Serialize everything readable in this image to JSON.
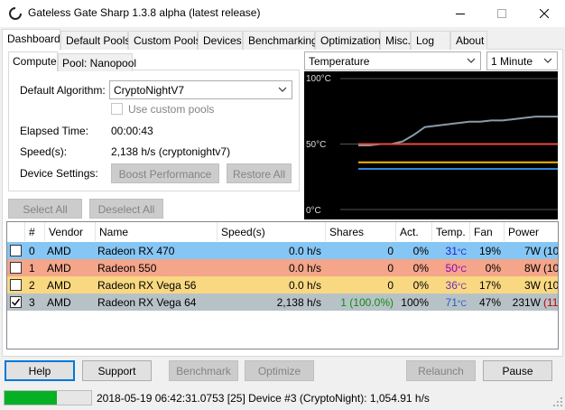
{
  "window": {
    "title": "Gateless Gate Sharp 1.3.8 alpha (latest release)"
  },
  "tabs": [
    "Dashboard",
    "Default Pools",
    "Custom Pools",
    "Devices",
    "Benchmarking",
    "Optimization",
    "Misc.",
    "Log",
    "About"
  ],
  "subtabs": [
    "Compute",
    "Pool: Nanopool"
  ],
  "compute": {
    "default_algorithm_label": "Default Algorithm:",
    "default_algorithm_value": "CryptoNightV7",
    "use_custom_pools_label": "Use custom pools",
    "elapsed_label": "Elapsed Time:",
    "elapsed_value": "00:00:43",
    "speed_label": "Speed(s):",
    "speed_value": "2,138 h/s (cryptonightv7)",
    "device_settings_label": "Device Settings:",
    "boost_label": "Boost Performance",
    "restore_label": "Restore All"
  },
  "select_all_label": "Select All",
  "deselect_all_label": "Deselect All",
  "chart_controls": {
    "metric": "Temperature",
    "interval": "1 Minute"
  },
  "chart_data": {
    "type": "line",
    "y_ticks": [
      "100°C",
      "50°C",
      "0°C"
    ],
    "ylim": [
      0,
      100
    ],
    "series": [
      {
        "color": "#8a9ba8",
        "values": [
          49,
          49,
          50,
          50,
          52,
          57,
          63,
          64,
          65,
          66,
          67,
          67,
          68,
          68,
          69,
          70,
          71,
          71,
          71
        ]
      },
      {
        "color": "#e74c3c",
        "values": [
          50,
          50,
          50,
          50,
          50,
          50,
          50,
          50,
          50,
          50,
          50,
          50,
          50,
          50,
          50,
          50,
          50,
          50,
          50
        ]
      },
      {
        "color": "#f5b400",
        "values": [
          36,
          36,
          36,
          36,
          36,
          36,
          36,
          36,
          36,
          36,
          36,
          36,
          36,
          36,
          36,
          36,
          36,
          36,
          36
        ]
      },
      {
        "color": "#9b6bd6",
        "values": [
          31,
          31,
          31,
          31,
          31,
          31,
          31,
          31,
          31,
          31,
          31,
          31,
          31,
          31,
          31,
          31,
          31,
          31,
          31
        ]
      },
      {
        "color": "#2e86de",
        "values": [
          31,
          31,
          31,
          31,
          31,
          31,
          31,
          31,
          31,
          31,
          31,
          31,
          31,
          31,
          31,
          31,
          31,
          31,
          31
        ]
      }
    ]
  },
  "table": {
    "headers": [
      "#",
      "Vendor",
      "Name",
      "Speed(s)",
      "Shares",
      "Act.",
      "Temp.",
      "Fan",
      "Power"
    ],
    "rows": [
      {
        "checked": false,
        "num": "0",
        "vendor": "AMD",
        "name": "Radeon RX 470",
        "speed": "0.0 h/s",
        "shares": "0",
        "act": "0%",
        "temp": "31",
        "temp_unit": "°C",
        "fan": "19%",
        "power": "7W",
        "power_extra": "(10",
        "bg": "#86c6f4",
        "temp_color": "#2020d0"
      },
      {
        "checked": false,
        "num": "1",
        "vendor": "AMD",
        "name": "Radeon 550",
        "speed": "0.0 h/s",
        "shares": "0",
        "act": "0%",
        "temp": "50",
        "temp_unit": "°C",
        "fan": "0%",
        "power": "8W",
        "power_extra": "(10",
        "bg": "#f4a58a",
        "temp_color": "#8a00c0"
      },
      {
        "checked": false,
        "num": "2",
        "vendor": "AMD",
        "name": "Radeon RX Vega 56",
        "speed": "0.0 h/s",
        "shares": "0",
        "act": "0%",
        "temp": "36",
        "temp_unit": "°C",
        "fan": "17%",
        "power": "3W",
        "power_extra": "(10",
        "bg": "#f9d882",
        "temp_color": "#6b2fc0"
      },
      {
        "checked": true,
        "num": "3",
        "vendor": "AMD",
        "name": "Radeon RX Vega 64",
        "speed": "2,138 h/s",
        "shares": "1 (100.0%)",
        "act": "100%",
        "temp": "71",
        "temp_unit": "°C",
        "fan": "47%",
        "power": "231W",
        "power_extra": "(11",
        "bg": "#b7c2c7",
        "temp_color": "#2060c0",
        "shares_color": "#138a13",
        "power_extra_color": "#c00000"
      }
    ]
  },
  "buttons": {
    "help": "Help",
    "support": "Support",
    "benchmark": "Benchmark",
    "optimize": "Optimize",
    "relaunch": "Relaunch",
    "pause": "Pause"
  },
  "status": {
    "progress": 0.6,
    "text": "2018-05-19 06:42:31.0753 [25] Device #3 (CryptoNight): 1,054.91 h/s"
  }
}
